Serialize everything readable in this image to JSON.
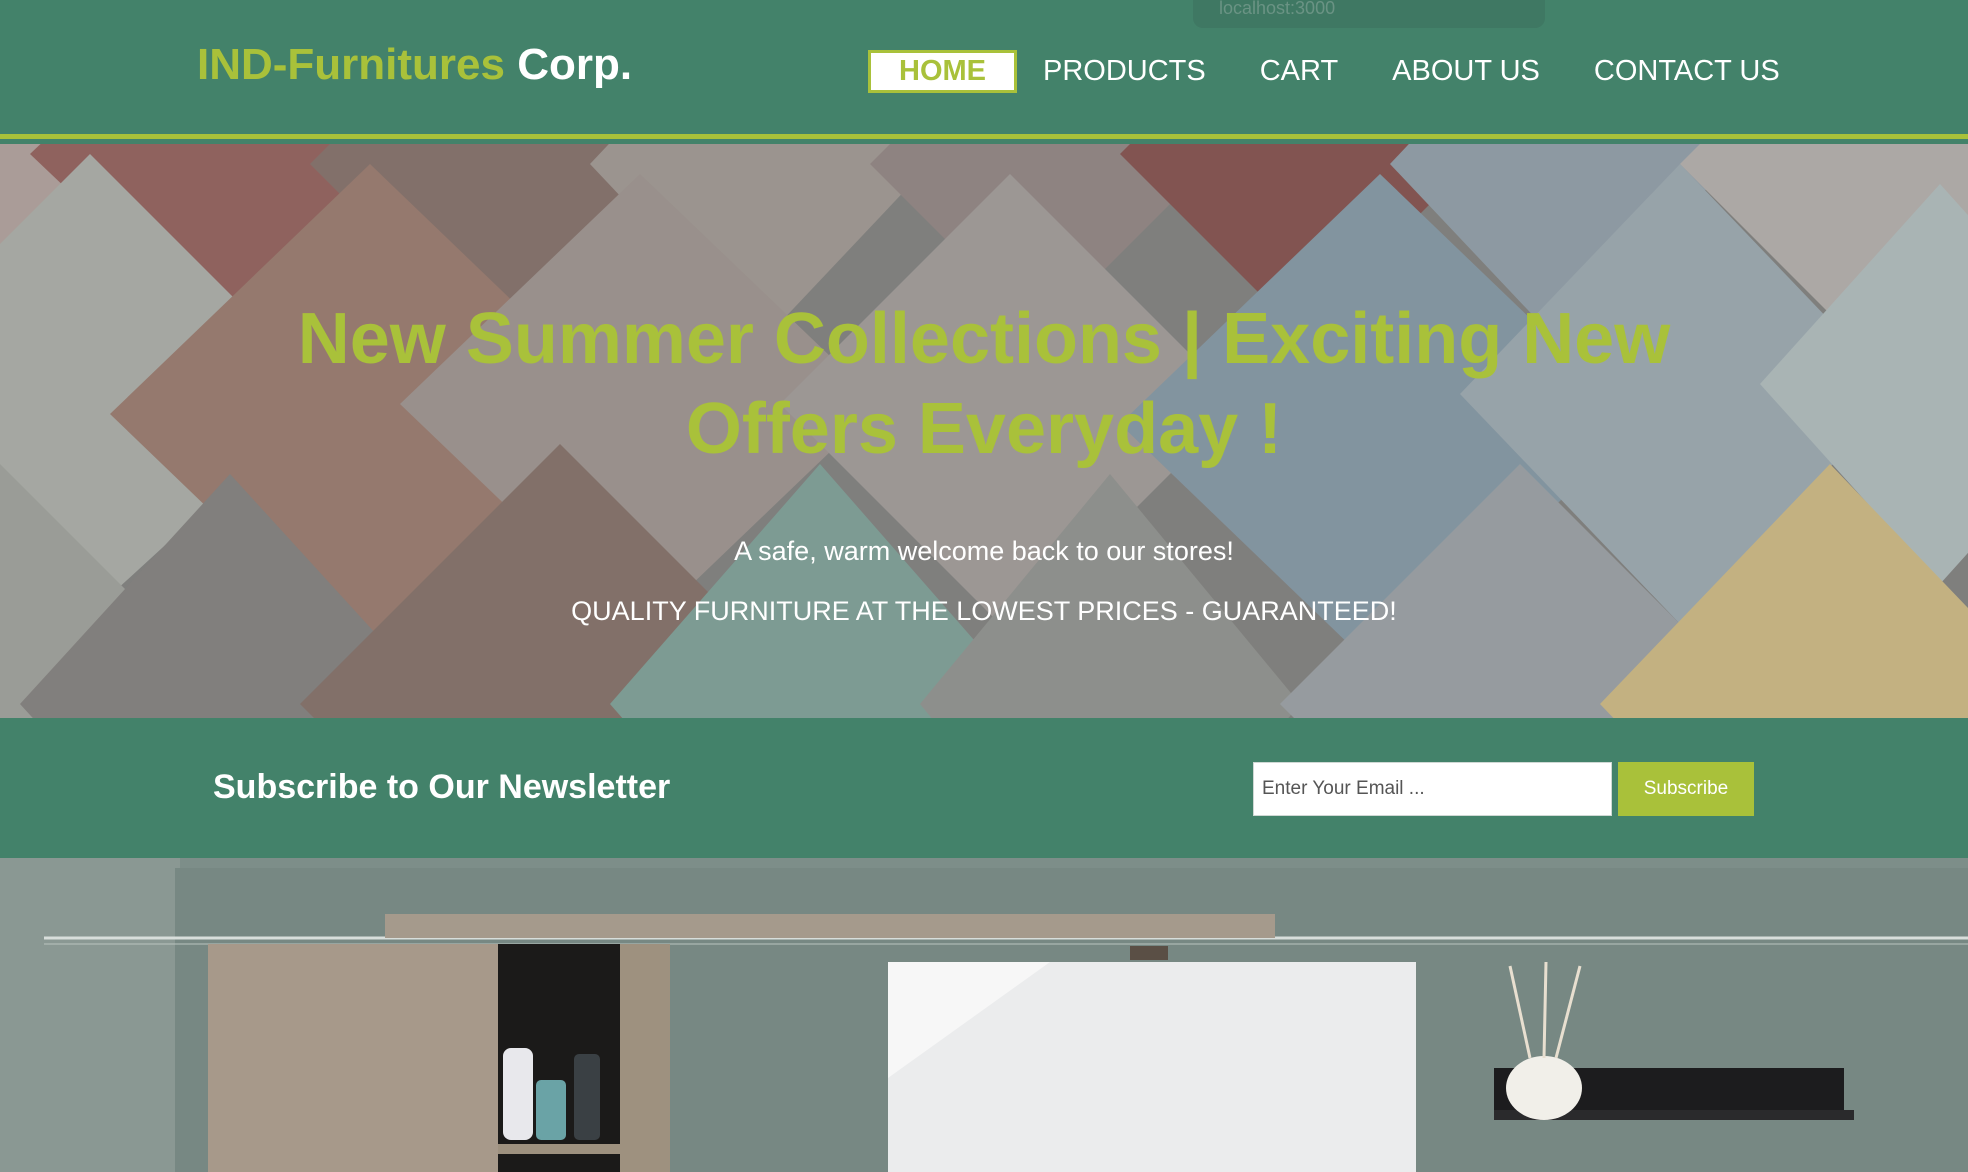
{
  "browser": {
    "url_hint": "localhost:3000"
  },
  "brand": {
    "name_part1": "IND-Furnitures",
    "name_part2": "Corp."
  },
  "nav": {
    "items": [
      {
        "label": "HOME",
        "active": true
      },
      {
        "label": "PRODUCTS",
        "active": false
      },
      {
        "label": "CART",
        "active": false
      },
      {
        "label": "ABOUT US",
        "active": false
      },
      {
        "label": "CONTACT US",
        "active": false
      }
    ]
  },
  "hero": {
    "title": "New Summer Collections | Exciting New Offers Everyday !",
    "subtitle": "A safe, warm welcome back to our stores!",
    "tagline": "QUALITY FURNITURE AT THE LOWEST PRICES - GUARANTEED!"
  },
  "newsletter": {
    "title": "Subscribe to Our Newsletter",
    "email_placeholder": "Enter Your Email ...",
    "email_value": "",
    "button_label": "Subscribe"
  },
  "colors": {
    "primary_green": "#43826a",
    "accent_lime": "#a9c13a",
    "white": "#ffffff"
  }
}
